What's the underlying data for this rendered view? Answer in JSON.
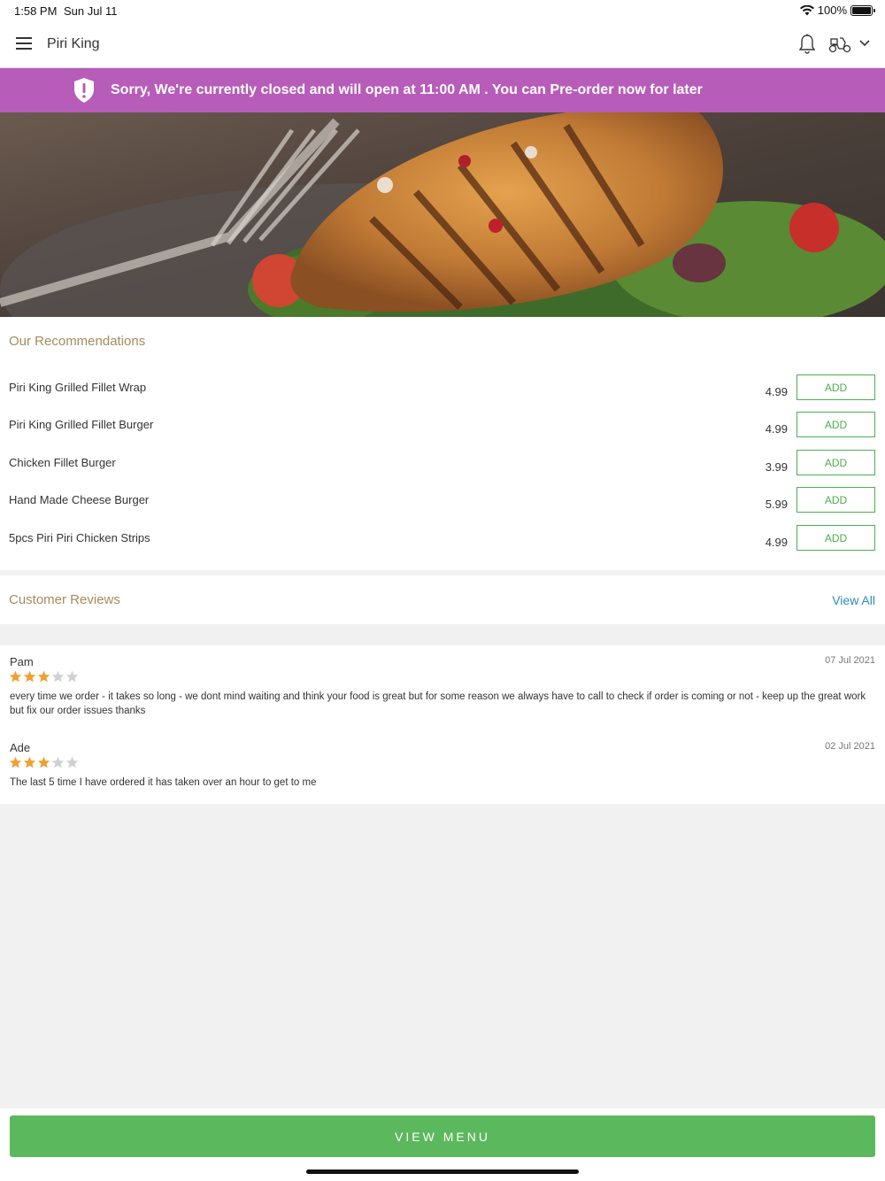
{
  "status_bar": {
    "time": "1:58 PM",
    "date": "Sun Jul 11",
    "battery": "100%"
  },
  "header": {
    "title": "Piri King"
  },
  "banner": {
    "message": "Sorry, We're currently closed and will open at 11:00 AM . You can Pre-order now for later",
    "color": "#b75cb8"
  },
  "recommendations": {
    "title": "Our Recommendations",
    "items": [
      {
        "name": "Piri King Grilled Fillet Wrap",
        "price": "4.99",
        "button": "ADD"
      },
      {
        "name": "Piri King Grilled Fillet Burger",
        "price": "4.99",
        "button": "ADD"
      },
      {
        "name": "Chicken Fillet Burger",
        "price": "3.99",
        "button": "ADD"
      },
      {
        "name": "Hand Made Cheese Burger",
        "price": "5.99",
        "button": "ADD"
      },
      {
        "name": "5pcs Piri Piri Chicken Strips",
        "price": "4.99",
        "button": "ADD"
      }
    ]
  },
  "reviews": {
    "title": "Customer Reviews",
    "view_all": "View All",
    "items": [
      {
        "name": "Pam",
        "date": "07 Jul 2021",
        "rating": 3,
        "max_rating": 5,
        "text": "every time we order - it takes so long - we dont mind waiting and think your food is great but for some reason we always have to call to check if order is coming or not - keep up the great work but fix our order issues thanks"
      },
      {
        "name": "Ade",
        "date": "02 Jul 2021",
        "rating": 3,
        "max_rating": 5,
        "text": "The last 5 time I have ordered it has taken over an hour to get to me"
      }
    ]
  },
  "footer": {
    "button": "VIEW MENU",
    "color": "#5cb85c"
  }
}
